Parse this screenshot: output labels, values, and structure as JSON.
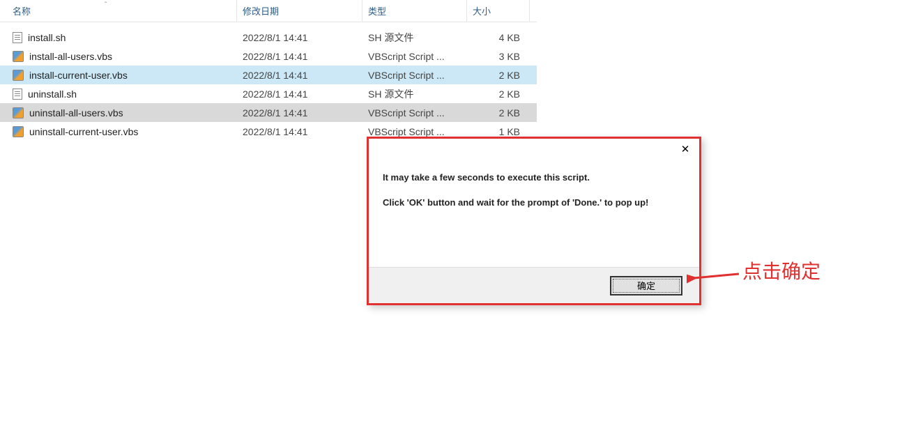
{
  "columns": {
    "name": "名称",
    "date": "修改日期",
    "type": "类型",
    "size": "大小"
  },
  "files": [
    {
      "icon": "sh",
      "name": "install.sh",
      "date": "2022/8/1 14:41",
      "type": "SH 源文件",
      "size": "4 KB",
      "state": ""
    },
    {
      "icon": "vbs",
      "name": "install-all-users.vbs",
      "date": "2022/8/1 14:41",
      "type": "VBScript Script ...",
      "size": "3 KB",
      "state": ""
    },
    {
      "icon": "vbs",
      "name": "install-current-user.vbs",
      "date": "2022/8/1 14:41",
      "type": "VBScript Script ...",
      "size": "2 KB",
      "state": "selected-blue"
    },
    {
      "icon": "sh",
      "name": "uninstall.sh",
      "date": "2022/8/1 14:41",
      "type": "SH 源文件",
      "size": "2 KB",
      "state": ""
    },
    {
      "icon": "vbs",
      "name": "uninstall-all-users.vbs",
      "date": "2022/8/1 14:41",
      "type": "VBScript Script ...",
      "size": "2 KB",
      "state": "selected-gray"
    },
    {
      "icon": "vbs",
      "name": "uninstall-current-user.vbs",
      "date": "2022/8/1 14:41",
      "type": "VBScript Script ...",
      "size": "1 KB",
      "state": ""
    }
  ],
  "dialog": {
    "line1": "It may take a few seconds to execute this script.",
    "line2": "Click 'OK' button and wait for the prompt of 'Done.' to pop up!",
    "ok_label": "确定",
    "close_label": "✕"
  },
  "annotation": {
    "text": "点击确定"
  }
}
